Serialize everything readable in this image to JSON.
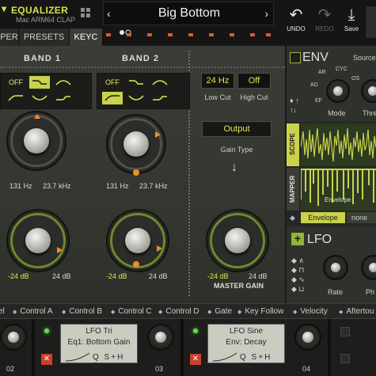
{
  "header": {
    "title": "EQUALIZER",
    "subtitle": "Mac ARM64  CLAP",
    "preset_name": "Big Bottom",
    "prev_arrow": "‹",
    "next_arrow": "›",
    "undo_label": "UNDO",
    "redo_label": "REDO",
    "save_label": "Save"
  },
  "tabs": [
    {
      "label": "PER"
    },
    {
      "label": "PRESETS"
    },
    {
      "label": "KEYC"
    }
  ],
  "bands": [
    {
      "title": "BAND 1",
      "off_label": "OFF",
      "freq_low": "131 Hz",
      "freq_high": "23.7 kHz",
      "gain_low": "-24 dB",
      "gain_high": "24 dB"
    },
    {
      "title": "BAND 2",
      "off_label": "OFF",
      "freq_low": "131 Hz",
      "freq_high": "23.7 kHz",
      "gain_low": "-24 dB",
      "gain_high": "24 dB"
    }
  ],
  "cuts": {
    "low_value": "24 Hz",
    "high_value": "Off",
    "low_label": "Low Cut",
    "high_label": "High Cut"
  },
  "output": {
    "button_label": "Output",
    "gain_type_label": "Gain Type",
    "gain_low": "-24 dB",
    "gain_high": "24 dB",
    "master_label": "MASTER GAIN"
  },
  "env": {
    "title": "ENV",
    "source_label": "Source",
    "ar_label": "AR",
    "cyc_label": "CYC",
    "ad_label": "AD",
    "os_label": "OS",
    "ef_label": "EF",
    "mode_label": "Mode",
    "thresh_label": "Thre",
    "scope_tab": "SCOPE",
    "mapper_tab": "MAPPER",
    "envelope_label": "Envelope",
    "envelope_btn": "Envelope",
    "none_btn": "none"
  },
  "lfo": {
    "title": "LFO",
    "rate_label": "Rate",
    "phase_label": "Ph"
  },
  "mod_sources": [
    "el",
    "Control A",
    "Control B",
    "Control C",
    "Control D",
    "Gate",
    "Key Follow",
    "Velocity",
    "Aftertou"
  ],
  "slots": [
    {
      "num": "02"
    },
    {
      "num": "03",
      "name": "LFO Tri",
      "target": "Eq1: Bottom Gain",
      "modes": "Q  S+H  SL"
    },
    {
      "num": "04",
      "name": "LFO Sine",
      "target": "Env: Decay",
      "modes": "Q  S+H  SL"
    }
  ],
  "colors": {
    "accent": "#c9d24a",
    "brand": "#d9e04a",
    "marker": "#f08d2a",
    "led": "#e05a22"
  }
}
